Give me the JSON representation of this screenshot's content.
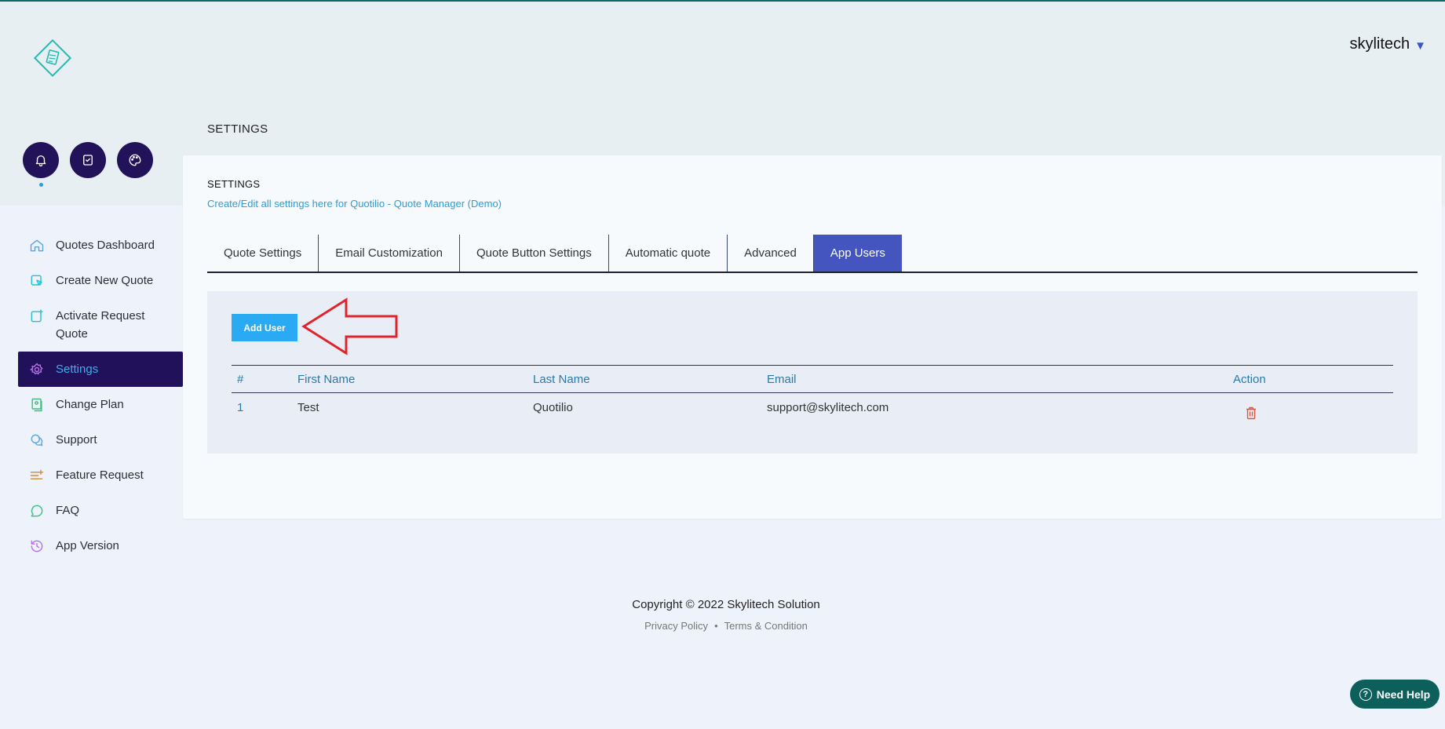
{
  "header": {
    "user_name": "skylitech",
    "caret": "▼",
    "page_heading": "SETTINGS"
  },
  "quick_icons": [
    "bell-icon",
    "checklist-icon",
    "palette-icon"
  ],
  "sidebar": {
    "items": [
      {
        "label": "Quotes Dashboard",
        "icon": "home-icon",
        "active": false
      },
      {
        "label": "Create New Quote",
        "icon": "create-quote-icon",
        "active": false
      },
      {
        "label": "Activate Request Quote",
        "icon": "activate-quote-icon",
        "active": false
      },
      {
        "label": "Settings",
        "icon": "gear-icon",
        "active": true
      },
      {
        "label": "Change Plan",
        "icon": "plan-icon",
        "active": false
      },
      {
        "label": "Support",
        "icon": "chat-icon",
        "active": false
      },
      {
        "label": "Feature Request",
        "icon": "list-plus-icon",
        "active": false
      },
      {
        "label": "FAQ",
        "icon": "faq-bubble-icon",
        "active": false
      },
      {
        "label": "App Version",
        "icon": "history-icon",
        "active": false
      }
    ]
  },
  "card": {
    "title": "SETTINGS",
    "subtitle": "Create/Edit all settings here for Quotilio - Quote Manager (Demo)"
  },
  "tabs": [
    {
      "label": "Quote Settings",
      "active": false
    },
    {
      "label": "Email Customization",
      "active": false
    },
    {
      "label": "Quote Button Settings",
      "active": false
    },
    {
      "label": "Automatic quote",
      "active": false
    },
    {
      "label": "Advanced",
      "active": false
    },
    {
      "label": "App Users",
      "active": true
    }
  ],
  "panel": {
    "add_button_label": "Add User"
  },
  "table": {
    "columns": [
      "#",
      "First Name",
      "Last Name",
      "Email",
      "Action"
    ],
    "rows": [
      {
        "num": "1",
        "first": "Test",
        "last": "Quotilio",
        "email": "support@skylitech.com"
      }
    ]
  },
  "footer": {
    "copyright": "Copyright © 2022 Skylitech Solution",
    "privacy": "Privacy Policy",
    "separator": "•",
    "terms": "Terms & Condition"
  },
  "help": {
    "label": "Need Help",
    "icon_glyph": "?"
  },
  "colors": {
    "sidebar_active_bg": "#21105a",
    "accent_blue": "#29aaf3",
    "tab_active_bg": "#4455c0",
    "help_bg": "#0d5f5b",
    "annotation_arrow": "#e0242b"
  }
}
